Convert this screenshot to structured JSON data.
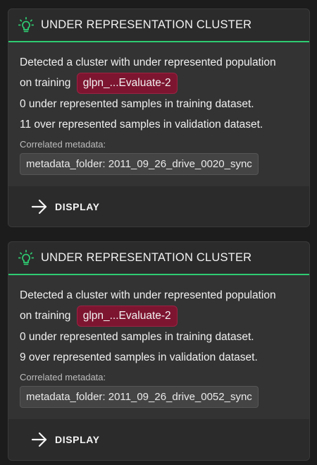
{
  "accent_color": "#2ecc71",
  "tag_color": "#7d1530",
  "cards": [
    {
      "icon": "lightbulb-icon",
      "title": "UNDER REPRESENTATION CLUSTER",
      "line1": "Detected a cluster with under represented population",
      "line2_prefix": "on training",
      "tag": "glpn_...Evaluate-2",
      "line3": "0 under represented samples in training dataset.",
      "line4": "11 over represented samples in validation dataset.",
      "meta_label": "Correlated metadata:",
      "meta_value": "metadata_folder: 2011_09_26_drive_0020_sync",
      "button_icon": "arrow-right-icon",
      "button_label": "DISPLAY"
    },
    {
      "icon": "lightbulb-icon",
      "title": "UNDER REPRESENTATION CLUSTER",
      "line1": "Detected a cluster with under represented population",
      "line2_prefix": "on training",
      "tag": "glpn_...Evaluate-2",
      "line3": "0 under represented samples in training dataset.",
      "line4": "9 over represented samples in validation dataset.",
      "meta_label": "Correlated metadata:",
      "meta_value": "metadata_folder: 2011_09_26_drive_0052_sync",
      "button_icon": "arrow-right-icon",
      "button_label": "DISPLAY"
    }
  ]
}
